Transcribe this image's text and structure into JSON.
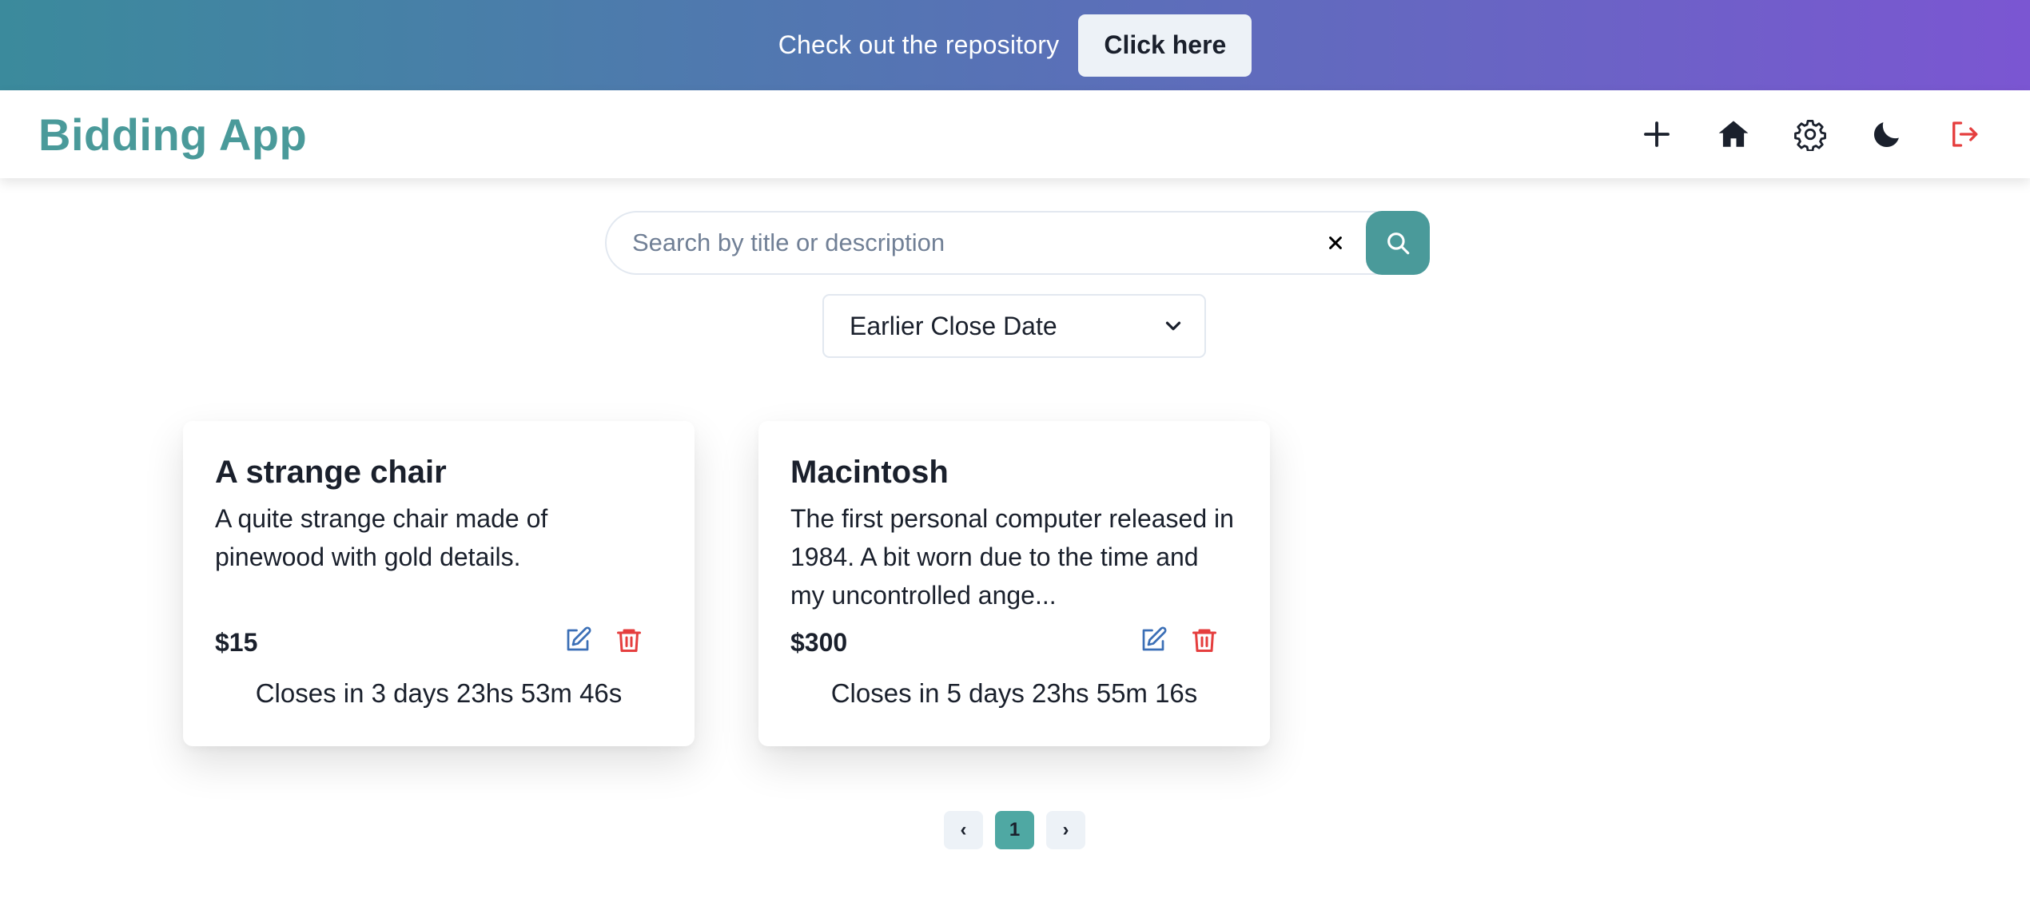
{
  "banner": {
    "text": "Check out the repository",
    "button_label": "Click here"
  },
  "navbar": {
    "title": "Bidding App",
    "icons": [
      "plus-icon",
      "home-icon",
      "gear-icon",
      "moon-icon",
      "logout-icon"
    ]
  },
  "search": {
    "placeholder": "Search by title or description",
    "value": ""
  },
  "sort": {
    "selected": "Earlier Close Date"
  },
  "cards": [
    {
      "title": "A strange chair",
      "description": "A quite strange chair made of pinewood with gold details.",
      "price": "$15",
      "closes": "Closes in 3 days 23hs 53m 46s"
    },
    {
      "title": "Macintosh",
      "description": "The first personal computer released in 1984. A bit worn due to the time and my uncontrolled ange...",
      "price": "$300",
      "closes": "Closes in 5 days 23hs 55m 16s"
    }
  ],
  "pagination": {
    "prev": "‹",
    "pages": [
      "1"
    ],
    "current": "1",
    "next": "›"
  },
  "colors": {
    "accent": "#4a9a9a",
    "banner_start": "#3b8a9c",
    "banner_end": "#7b56d2",
    "danger": "#e53e3e",
    "edit": "#3b6fb6"
  }
}
